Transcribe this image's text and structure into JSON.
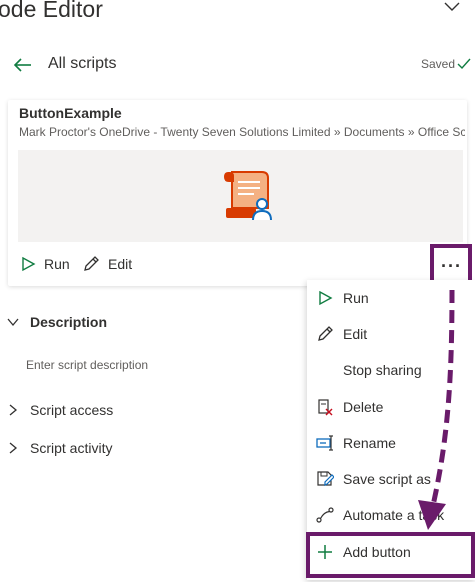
{
  "header": {
    "title": "ode Editor"
  },
  "nav": {
    "back_label": "All scripts",
    "status": "Saved"
  },
  "script": {
    "name": "ButtonExample",
    "path": "Mark Proctor's OneDrive - Twenty Seven Solutions Limited » Documents » Office Scripts"
  },
  "card_actions": {
    "run": "Run",
    "edit": "Edit",
    "more": "···"
  },
  "sections": {
    "description": "Description",
    "description_placeholder": "Enter script description",
    "access": "Script access",
    "activity": "Script activity"
  },
  "menu": {
    "items": [
      {
        "label": "Run",
        "icon": "play-icon"
      },
      {
        "label": "Edit",
        "icon": "pencil-icon"
      },
      {
        "label": "Stop sharing",
        "icon": ""
      },
      {
        "label": "Delete",
        "icon": "delete-icon"
      },
      {
        "label": "Rename",
        "icon": "rename-icon"
      },
      {
        "label": "Save script as",
        "icon": "save-as-icon"
      },
      {
        "label": "Automate a task",
        "icon": "flow-icon"
      },
      {
        "label": "Add button",
        "icon": "plus-icon"
      }
    ]
  },
  "colors": {
    "accent_green": "#107c41",
    "highlight": "#6a1b6a",
    "icon_orange": "#d83b01",
    "icon_teal": "#0f6cbd"
  }
}
